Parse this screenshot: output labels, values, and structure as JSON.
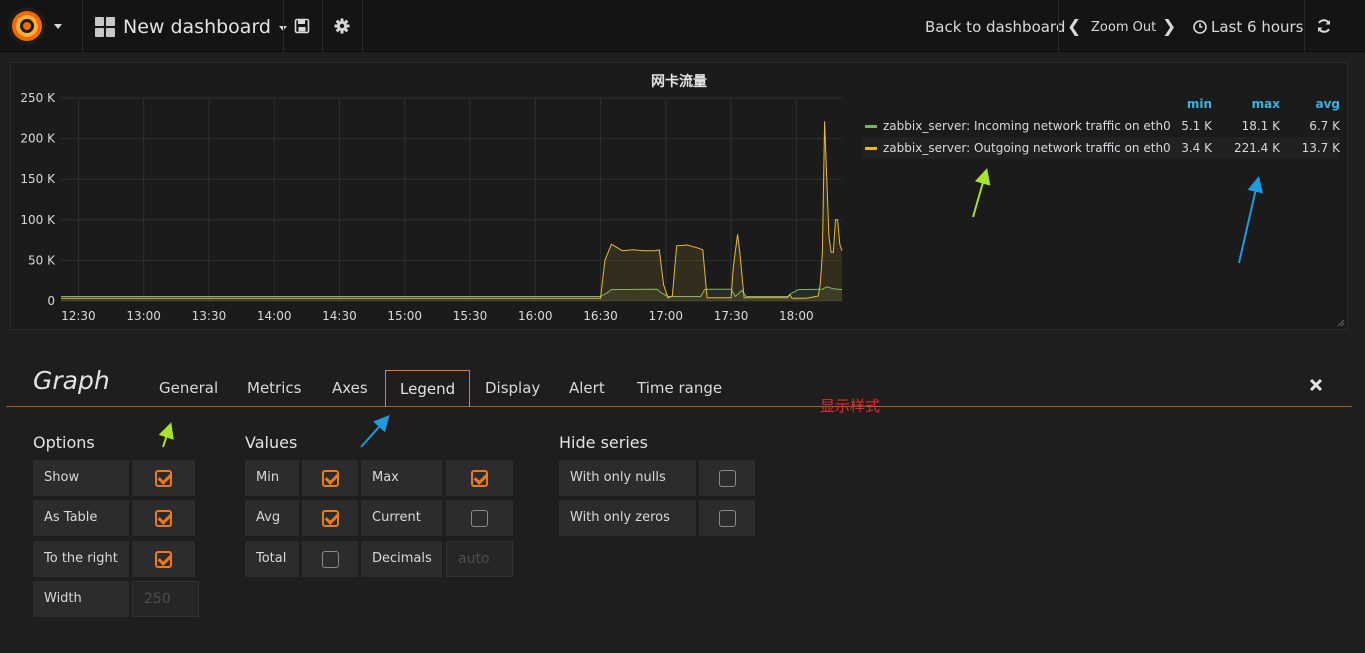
{
  "navbar": {
    "dashboard_title": "New dashboard",
    "back_label": "Back to dashboard",
    "zoom_label": "Zoom Out",
    "time_range_label": "Last 6 hours"
  },
  "panel": {
    "title": "网卡流量"
  },
  "chart_data": {
    "type": "line",
    "title": "网卡流量",
    "xlabel": "",
    "ylabel": "",
    "y_ticks": [
      "0",
      "50 K",
      "100 K",
      "150 K",
      "200 K",
      "250 K"
    ],
    "x_ticks": [
      "12:30",
      "13:00",
      "13:30",
      "14:00",
      "14:30",
      "15:00",
      "15:30",
      "16:00",
      "16:30",
      "17:00",
      "17:30",
      "18:00"
    ],
    "ylim": [
      0,
      250000
    ],
    "xlim_minutes": [
      742,
      1101
    ],
    "grid": true,
    "legend_placement": "right",
    "series": [
      {
        "name": "zabbix_server: Incoming network traffic on eth0",
        "color": "#7eb26d",
        "x_minutes": [
          742,
          990,
          993,
          995,
          1016,
          1018,
          1021,
          1036,
          1038,
          1050,
          1052,
          1055,
          1057,
          1076,
          1078,
          1081,
          1092,
          1094,
          1097,
          1101
        ],
        "values": [
          5500,
          5500,
          10000,
          14000,
          14500,
          10000,
          5500,
          5500,
          14500,
          14500,
          5500,
          13000,
          5500,
          5500,
          10000,
          14000,
          14500,
          17500,
          15000,
          14000
        ]
      },
      {
        "name": "zabbix_server: Outgoing network traffic on eth0",
        "color": "#eab839",
        "x_minutes": [
          742,
          990,
          992,
          995,
          1000,
          1005,
          1010,
          1015,
          1017,
          1019,
          1021,
          1023,
          1025,
          1030,
          1035,
          1037,
          1039,
          1050,
          1051,
          1052,
          1053,
          1054,
          1056,
          1076,
          1077,
          1078,
          1082,
          1084,
          1086,
          1088,
          1090,
          1091,
          1092,
          1093,
          1094,
          1095,
          1096,
          1097,
          1098,
          1099,
          1100,
          1101
        ],
        "values": [
          3400,
          3400,
          50000,
          70000,
          62000,
          63000,
          62000,
          62000,
          63000,
          20000,
          4000,
          6000,
          68000,
          69000,
          65000,
          63000,
          4000,
          4000,
          40000,
          62000,
          82000,
          60000,
          4000,
          4000,
          8000,
          3400,
          3400,
          3400,
          4000,
          5000,
          6000,
          20000,
          60000,
          221400,
          150000,
          80000,
          60000,
          60000,
          100000,
          100000,
          70000,
          62000
        ]
      }
    ]
  },
  "legend": {
    "headers": {
      "min": "min",
      "max": "max",
      "avg": "avg"
    },
    "rows": [
      {
        "name": "zabbix_server: Incoming network traffic on eth0",
        "color": "#7eb26d",
        "min": "5.1 K",
        "max": "18.1 K",
        "avg": "6.7 K"
      },
      {
        "name": "zabbix_server: Outgoing network traffic on eth0",
        "color": "#eab839",
        "min": "3.4 K",
        "max": "221.4 K",
        "avg": "13.7 K"
      }
    ]
  },
  "editor": {
    "title": "Graph",
    "tabs": [
      "General",
      "Metrics",
      "Axes",
      "Legend",
      "Display",
      "Alert",
      "Time range"
    ],
    "active_tab": "Legend",
    "annotation": "显示样式",
    "options": {
      "heading": "Options",
      "show": {
        "label": "Show",
        "checked": true
      },
      "as_table": {
        "label": "As Table",
        "checked": true
      },
      "to_right": {
        "label": "To the right",
        "checked": true
      },
      "width": {
        "label": "Width",
        "placeholder": "250"
      }
    },
    "values": {
      "heading": "Values",
      "min": {
        "label": "Min",
        "checked": true
      },
      "max": {
        "label": "Max",
        "checked": true
      },
      "avg": {
        "label": "Avg",
        "checked": true
      },
      "current": {
        "label": "Current",
        "checked": false
      },
      "total": {
        "label": "Total",
        "checked": false
      },
      "decimals": {
        "label": "Decimals",
        "placeholder": "auto"
      }
    },
    "hide_series": {
      "heading": "Hide series",
      "only_nulls": {
        "label": "With only nulls",
        "checked": false
      },
      "only_zeros": {
        "label": "With only zeros",
        "checked": false
      }
    }
  },
  "colors": {
    "accent": "#eb7b18",
    "legend_header": "#33b5e5",
    "annotation_green": "#a6e22e",
    "annotation_blue": "#1e9be0",
    "annotation_red": "#e8282c"
  }
}
